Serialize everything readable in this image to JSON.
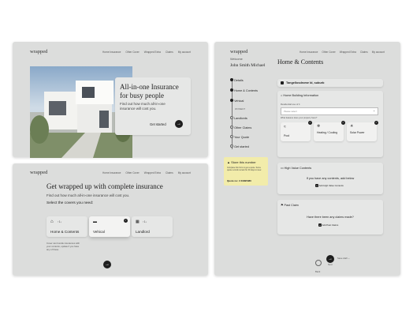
{
  "brand": "wrapped",
  "hero": {
    "nav": [
      "Home Insurance",
      "Other Cover",
      "Wrapped Extra",
      "Claims",
      "My account"
    ],
    "title": "All-in-one Insurance for busy people",
    "subtitle": "Find out how much all-in-one insurance will cost you.",
    "cta": "Get started"
  },
  "covers": {
    "nav": [
      "Home Insurance",
      "Other Cover",
      "Wrapped Extra",
      "Claims",
      "My account"
    ],
    "title": "Get wrapped up with complete insurance",
    "subtitle": "Find out how much all-in-one insurance will cost you.",
    "prompt": "Select the covers you need:",
    "stepper_value": "1",
    "options": [
      "Home & Contents",
      "Vehical",
      "Landlord"
    ],
    "footnote": "Cover can bundle insurances with your contents, update if you have any of these."
  },
  "form": {
    "nav": [
      "Home Insurance",
      "Other Cover",
      "Wrapped Extra",
      "Claims",
      "My account"
    ],
    "welcome": "Welcome",
    "user": "John Smith Michael",
    "title": "Home & Contents",
    "address": "Tangellosdrome Id, suburb",
    "steps": [
      "Details",
      "Home & Contents",
      "Vehical",
      "PAYMENT",
      "Landlords",
      "Other Claims",
      "Your Quote",
      "Get started"
    ],
    "building_header": "Home Building Information",
    "type_label": "Residential use of it",
    "select_placeholder": "Please select",
    "features_label": "What features does your property have?",
    "features": [
      "Pool",
      "Heating / Cooling",
      "Solar Power"
    ],
    "note_title": "Store this number",
    "note_text": "Complete this form to get a quote. Some quote records remain for 30 days to view.",
    "note_quote": "Quote no: # 23995380",
    "hv_header": "High Value Contents",
    "hv_question": "If you have any contents, add below",
    "hv_add": "Add High Value Contents",
    "claims_header": "Past Claim",
    "claims_question": "Have there been any claims made?",
    "claims_add": "Add Past Claims",
    "back_label": "Back",
    "next_label": "Next",
    "save_label": "Save draft"
  }
}
